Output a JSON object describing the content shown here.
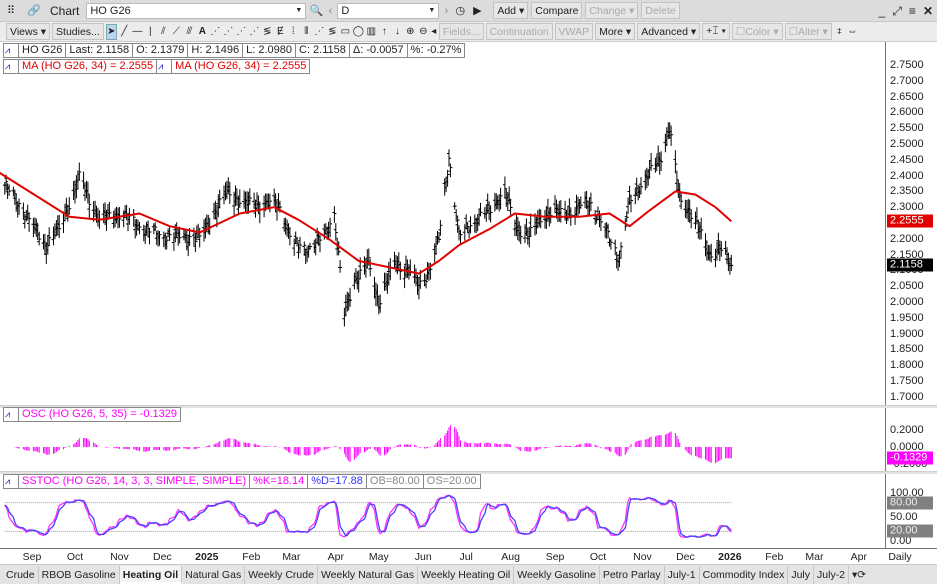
{
  "window": {
    "title": "Chart",
    "symbol": "HO G26",
    "interval": "D",
    "add": "Add",
    "compare": "Compare",
    "change": "Change",
    "delete": "Delete"
  },
  "toolbar": {
    "views": "Views",
    "studies": "Studies...",
    "fields": "Fields...",
    "continuation": "Continuation",
    "vwap": "VWAP",
    "more": "More",
    "advanced": "Advanced",
    "color": "Color",
    "alter": "Alter"
  },
  "quote": {
    "symbol": "HO G26",
    "last": "Last: 2.1158",
    "open": "O: 2.1379",
    "high": "H: 2.1496",
    "low": "L: 2.0980",
    "close": "C: 2.1158",
    "change": "Δ: -0.0057",
    "pct": "%: -0.27%"
  },
  "ma_legend": [
    "MA (HO G26, 34) = 2.2555",
    "MA (HO G26, 34) = 2.2555"
  ],
  "osc_legend": "OSC (HO G26, 5, 35) = -0.1329",
  "sstoc_legend": {
    "name": "SSTOC (HO G26, 14, 3, 3, SIMPLE, SIMPLE)",
    "k": "%K=18.14",
    "d": "%D=17.88",
    "ob": "OB=80.00",
    "os": "OS=20.00"
  },
  "price_axis": {
    "ticks": [
      "2.7500",
      "2.7000",
      "2.6500",
      "2.6000",
      "2.5500",
      "2.5000",
      "2.4500",
      "2.4000",
      "2.3500",
      "2.3000",
      "2.2500",
      "2.2000",
      "2.1500",
      "2.1000",
      "2.0500",
      "2.0000",
      "1.9500",
      "1.9000",
      "1.8500",
      "1.8000",
      "1.7500",
      "1.7000"
    ],
    "ma_tag": "2.2555",
    "last_tag": "2.1158"
  },
  "osc_axis": {
    "ticks": [
      "0.2000",
      "0.0000",
      "-0.2000"
    ],
    "tag": "-0.1329"
  },
  "stoch_axis": {
    "ticks": [
      "100.00",
      "50.00",
      "0.00"
    ],
    "ob_tag": "80.00",
    "os_tag": "20.00"
  },
  "time_axis": {
    "labels": [
      [
        "Sep",
        "2024-09-01"
      ],
      [
        "Oct",
        "2024-10-01"
      ],
      [
        "Nov",
        "2024-11-01"
      ],
      [
        "Dec",
        "2024-12-01"
      ],
      [
        "2025",
        "2025-01-01"
      ],
      [
        "Feb",
        "2025-02-01"
      ],
      [
        "Mar",
        "2025-03-01"
      ],
      [
        "Apr",
        "2025-04-01"
      ],
      [
        "May",
        "2025-05-01"
      ],
      [
        "Jun",
        "2025-06-01"
      ],
      [
        "Jul",
        "2025-07-01"
      ],
      [
        "Aug",
        "2025-08-01"
      ],
      [
        "Sep",
        "2025-09-01"
      ],
      [
        "Oct",
        "2025-10-01"
      ],
      [
        "Nov",
        "2025-11-01"
      ],
      [
        "Dec",
        "2025-12-01"
      ],
      [
        "2026",
        "2026-01-01"
      ],
      [
        "Feb",
        "2026-02-01"
      ],
      [
        "Mar",
        "2026-03-01"
      ],
      [
        "Apr",
        "2026-04-01"
      ]
    ],
    "period": "Daily"
  },
  "tabs": [
    {
      "label": "Crude"
    },
    {
      "label": "RBOB Gasoline"
    },
    {
      "label": "Heating Oil",
      "active": true
    },
    {
      "label": "Natural Gas"
    },
    {
      "label": "Weekly Crude"
    },
    {
      "label": "Weekly Natural Gas"
    },
    {
      "label": "Weekly Heating Oil"
    },
    {
      "label": "Weekly Gasoline"
    },
    {
      "label": "Petro Parlay"
    },
    {
      "label": "July-1"
    },
    {
      "label": "Commodity Index"
    },
    {
      "label": "July"
    },
    {
      "label": "July-2"
    }
  ],
  "colors": {
    "ma": "#e00000",
    "osc": "#ff00ff",
    "k": "#ff33ff",
    "d": "#4444ff",
    "last_tag": "#000000"
  },
  "chart_data": {
    "type": "ohlc",
    "symbol": "HO G26",
    "ylim": [
      1.7,
      2.75
    ],
    "close": [
      [
        "2024-08-13",
        2.37
      ],
      [
        "2024-08-23",
        2.31
      ],
      [
        "2024-09-10",
        2.18
      ],
      [
        "2024-09-20",
        2.23
      ],
      [
        "2024-10-04",
        2.39
      ],
      [
        "2024-10-18",
        2.26
      ],
      [
        "2024-11-01",
        2.28
      ],
      [
        "2024-11-15",
        2.24
      ],
      [
        "2024-11-29",
        2.21
      ],
      [
        "2024-12-13",
        2.21
      ],
      [
        "2024-12-27",
        2.2
      ],
      [
        "2025-01-06",
        2.28
      ],
      [
        "2025-01-16",
        2.35
      ],
      [
        "2025-01-27",
        2.31
      ],
      [
        "2025-02-10",
        2.31
      ],
      [
        "2025-02-20",
        2.31
      ],
      [
        "2025-03-03",
        2.18
      ],
      [
        "2025-03-13",
        2.17
      ],
      [
        "2025-03-24",
        2.21
      ],
      [
        "2025-03-31",
        2.28
      ],
      [
        "2025-04-07",
        1.96
      ],
      [
        "2025-04-14",
        2.07
      ],
      [
        "2025-04-24",
        2.12
      ],
      [
        "2025-05-01",
        2.0
      ],
      [
        "2025-05-12",
        2.12
      ],
      [
        "2025-05-22",
        2.1
      ],
      [
        "2025-05-29",
        2.05
      ],
      [
        "2025-06-05",
        2.1
      ],
      [
        "2025-06-12",
        2.2
      ],
      [
        "2025-06-19",
        2.46
      ],
      [
        "2025-06-26",
        2.21
      ],
      [
        "2025-07-07",
        2.26
      ],
      [
        "2025-07-17",
        2.29
      ],
      [
        "2025-07-28",
        2.35
      ],
      [
        "2025-08-04",
        2.24
      ],
      [
        "2025-08-14",
        2.21
      ],
      [
        "2025-08-25",
        2.28
      ],
      [
        "2025-09-04",
        2.28
      ],
      [
        "2025-09-15",
        2.29
      ],
      [
        "2025-09-25",
        2.32
      ],
      [
        "2025-10-06",
        2.23
      ],
      [
        "2025-10-16",
        2.14
      ],
      [
        "2025-10-23",
        2.32
      ],
      [
        "2025-11-03",
        2.39
      ],
      [
        "2025-11-13",
        2.45
      ],
      [
        "2025-11-20",
        2.55
      ],
      [
        "2025-11-27",
        2.32
      ],
      [
        "2025-12-04",
        2.29
      ],
      [
        "2025-12-11",
        2.22
      ],
      [
        "2025-12-18",
        2.15
      ],
      [
        "2025-12-25",
        2.17
      ],
      [
        "2026-01-02",
        2.1158
      ]
    ],
    "ma34": [
      [
        "2024-08-09",
        2.41
      ],
      [
        "2024-08-30",
        2.35
      ],
      [
        "2024-09-27",
        2.27
      ],
      [
        "2024-10-18",
        2.26
      ],
      [
        "2024-11-15",
        2.28
      ],
      [
        "2024-12-06",
        2.24
      ],
      [
        "2024-12-27",
        2.22
      ],
      [
        "2025-01-24",
        2.28
      ],
      [
        "2025-02-17",
        2.3
      ],
      [
        "2025-03-06",
        2.26
      ],
      [
        "2025-03-27",
        2.2
      ],
      [
        "2025-04-17",
        2.13
      ],
      [
        "2025-05-08",
        2.11
      ],
      [
        "2025-05-29",
        2.09
      ],
      [
        "2025-06-12",
        2.13
      ],
      [
        "2025-06-26",
        2.18
      ],
      [
        "2025-07-17",
        2.23
      ],
      [
        "2025-08-04",
        2.28
      ],
      [
        "2025-08-25",
        2.27
      ],
      [
        "2025-09-18",
        2.27
      ],
      [
        "2025-10-09",
        2.28
      ],
      [
        "2025-10-23",
        2.24
      ],
      [
        "2025-11-06",
        2.29
      ],
      [
        "2025-11-24",
        2.35
      ],
      [
        "2025-12-08",
        2.34
      ],
      [
        "2025-12-22",
        2.3
      ],
      [
        "2026-01-02",
        2.2555
      ]
    ]
  }
}
